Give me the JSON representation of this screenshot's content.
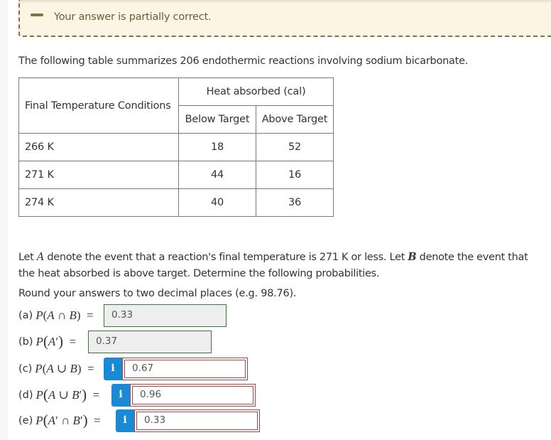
{
  "feedback": {
    "icon": "minus-icon",
    "message": "Your answer is partially correct.",
    "colors": {
      "background": "#fcf5e3",
      "border": "#8c6d3f",
      "text": "#6f5a3a"
    }
  },
  "intro": "The following table summarizes 206 endothermic reactions involving sodium bicarbonate.",
  "table": {
    "row_header": "Final Temperature Conditions",
    "group_header": "Heat absorbed (cal)",
    "columns": [
      "Below Target",
      "Above Target"
    ],
    "rows": [
      {
        "label": "266 K",
        "values": [
          "18",
          "52"
        ]
      },
      {
        "label": "271 K",
        "values": [
          "44",
          "16"
        ]
      },
      {
        "label": "274 K",
        "values": [
          "40",
          "36"
        ]
      }
    ]
  },
  "problem": {
    "line1_pre": "Let ",
    "var_a": "A",
    "line1_mid": " denote the event that a reaction's final temperature is 271 K or less. Let ",
    "var_b": "B",
    "line1_post": " denote the event that the heat absorbed is above target. Determine the following probabilities.",
    "round_note": "Round your answers to two decimal places (e.g. 98.76)."
  },
  "questions": [
    {
      "part": "(a)",
      "expr": "P(A ∩ B)",
      "equals": "=",
      "value": "0.33",
      "status": "correct"
    },
    {
      "part": "(b)",
      "expr": "P(A′)",
      "equals": "=",
      "value": "0.37",
      "status": "correct"
    },
    {
      "part": "(c)",
      "expr": "P(A ∪ B)",
      "equals": "=",
      "value": "0.67",
      "status": "incorrect",
      "info_icon": "i"
    },
    {
      "part": "(d)",
      "expr": "P(A ∪ B′)",
      "equals": "=",
      "value": "0.96",
      "status": "incorrect",
      "info_icon": "i"
    },
    {
      "part": "(e)",
      "expr": "P(A′ ∩ B′)",
      "equals": "=",
      "value": "0.33",
      "status": "incorrect",
      "info_icon": "i"
    }
  ],
  "status_colors": {
    "correct_border": "#3c763d",
    "incorrect_border": "#a94442",
    "info_button": "#1a8ad6"
  }
}
